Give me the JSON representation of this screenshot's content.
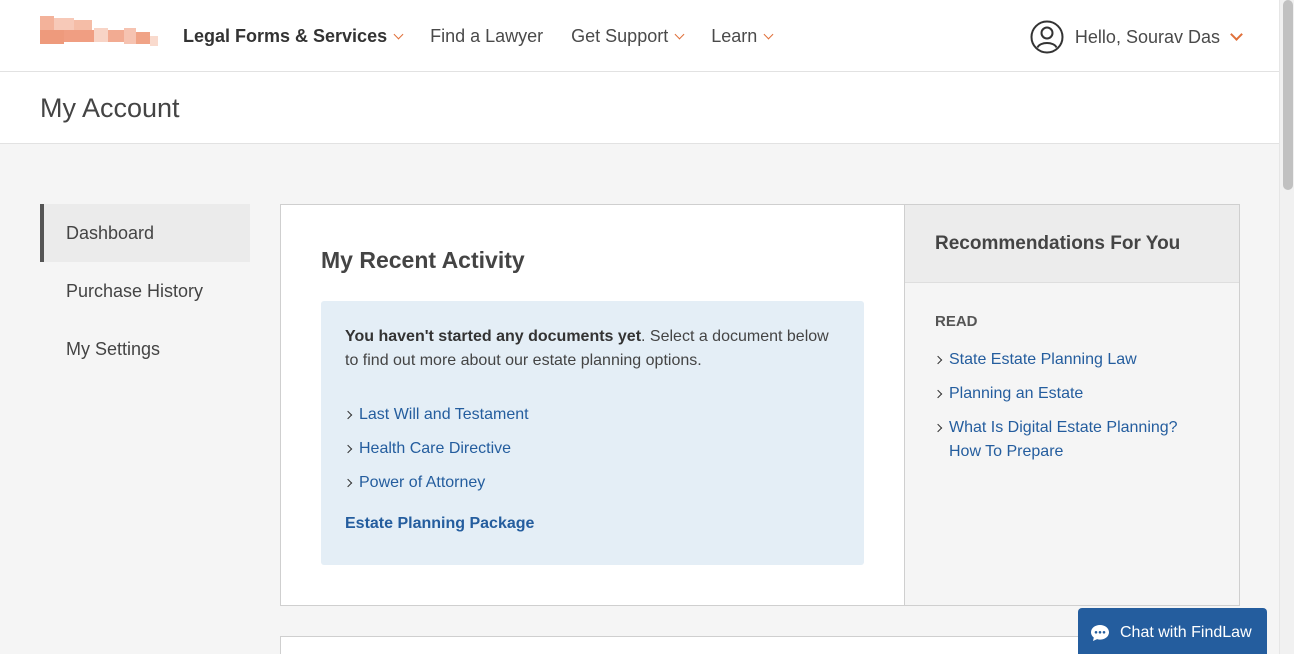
{
  "header": {
    "nav": [
      {
        "label": "Legal Forms & Services",
        "has_dropdown": true,
        "bold": true
      },
      {
        "label": "Find a Lawyer",
        "has_dropdown": false,
        "bold": false
      },
      {
        "label": "Get Support",
        "has_dropdown": true,
        "bold": false
      },
      {
        "label": "Learn",
        "has_dropdown": true,
        "bold": false
      }
    ],
    "user_greeting": "Hello, Sourav Das",
    "accent_color": "#e0703a"
  },
  "page_title": "My Account",
  "sidebar": {
    "items": [
      {
        "label": "Dashboard",
        "active": true
      },
      {
        "label": "Purchase History",
        "active": false
      },
      {
        "label": "My Settings",
        "active": false
      }
    ]
  },
  "activity": {
    "title": "My Recent Activity",
    "notice_bold": "You haven't started any documents yet",
    "notice_rest": ". Select a document below to find out more about our estate planning options.",
    "links": [
      "Last Will and Testament",
      "Health Care Directive",
      "Power of Attorney"
    ],
    "package_link": "Estate Planning Package"
  },
  "recommendations": {
    "title": "Recommendations For You",
    "section_label": "READ",
    "links": [
      "State Estate Planning Law",
      "Planning an Estate",
      "What Is Digital Estate Planning? How To Prepare"
    ]
  },
  "chat": {
    "label": "Chat with FindLaw",
    "color": "#245d9e"
  },
  "link_color": "#245d9e"
}
